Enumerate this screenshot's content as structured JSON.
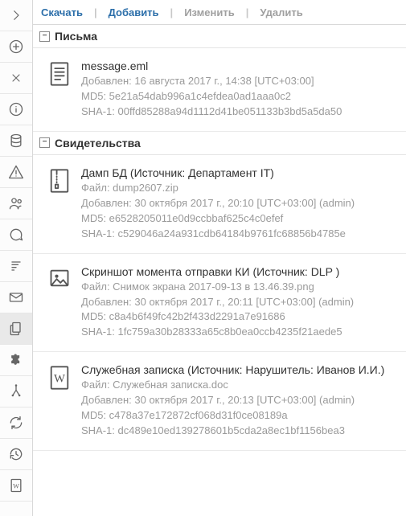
{
  "sidebar": [
    {
      "icon": "chevron-right"
    },
    {
      "icon": "plus-circle"
    },
    {
      "icon": "x"
    },
    {
      "icon": "info-circle"
    },
    {
      "icon": "database"
    },
    {
      "icon": "warning-triangle"
    },
    {
      "icon": "users"
    },
    {
      "icon": "speech-bubble"
    },
    {
      "icon": "sort-lines"
    },
    {
      "icon": "envelope"
    },
    {
      "icon": "documents",
      "selected": true
    },
    {
      "icon": "puzzle"
    },
    {
      "icon": "branch"
    },
    {
      "icon": "sync"
    },
    {
      "icon": "history"
    },
    {
      "icon": "word-doc"
    }
  ],
  "toolbar": {
    "download": "Скачать",
    "add": "Добавить",
    "edit": "Изменить",
    "delete": "Удалить"
  },
  "groups": [
    {
      "title": "Письма",
      "items": [
        {
          "icon": "text-doc",
          "title": "message.eml",
          "lines": [
            "Добавлен: 16 августа 2017 г., 14:38 [UTC+03:00]",
            "MD5: 5e21a54dab996a1c4efdea0ad1aaa0c2",
            "SHA-1: 00ffd85288a94d1112d41be051133b3bd5a5da50"
          ]
        }
      ]
    },
    {
      "title": "Свидетельства",
      "items": [
        {
          "icon": "zip",
          "title": "Дамп БД (Источник: Департамент IT)",
          "lines": [
            "Файл: dump2607.zip",
            "Добавлен: 30 октября 2017 г., 20:10 [UTC+03:00] (admin)",
            "MD5: e6528205011e0d9ccbbaf625c4c0efef",
            "SHA-1: c529046a24a931cdb64184b9761fc68856b4785e"
          ]
        },
        {
          "icon": "image",
          "title": "Скриншот момента отправки КИ (Источник: DLP )",
          "lines": [
            "Файл: Снимок экрана 2017-09-13 в 13.46.39.png",
            "Добавлен: 30 октября 2017 г., 20:11 [UTC+03:00] (admin)",
            "MD5: c8a4b6f49fc42b2f433d2291a7e91686",
            "SHA-1: 1fc759a30b28333a65c8b0ea0ccb4235f21aede5"
          ]
        },
        {
          "icon": "word",
          "title": "Служебная записка (Источник: Нарушитель: Иванов И.И.)",
          "lines": [
            "Файл: Служебная записка.doc",
            "Добавлен: 30 октября 2017 г., 20:13 [UTC+03:00] (admin)",
            "MD5: c478a37e172872cf068d31f0ce08189a",
            "SHA-1: dc489e10ed139278601b5cda2a8ec1bf1156bea3"
          ]
        }
      ]
    }
  ]
}
